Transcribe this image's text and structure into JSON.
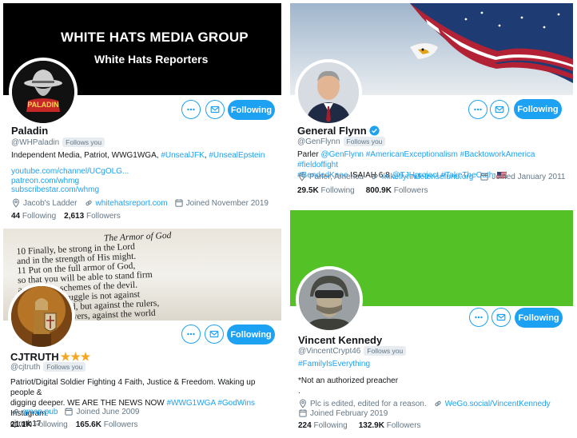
{
  "cards": {
    "paladin": {
      "banner_title": "WHITE HATS MEDIA GROUP",
      "banner_subtitle": "White Hats Reporters",
      "avatar_text": "PALADIN",
      "name": "Paladin",
      "handle": "@WHPaladin",
      "follows_you": "Follows you",
      "bio_plain": "Independent Media, Patriot, WWG1WGA, ",
      "bio_tag1": "#UnsealJFK",
      "bio_sep": ", ",
      "bio_tag2": "#UnsealEpstein",
      "link1": "youtube.com/channel/UCgOLG...",
      "link2": "patreon.com/whmg",
      "link3": "subscribestar.com/whmg",
      "location": "Jacob's Ladder",
      "website": "whitehatsreport.com",
      "joined": "Joined November 2019",
      "following_count": "44",
      "following_label": "Following",
      "followers_count": "2,613",
      "followers_label": "Followers",
      "follow_button": "Following"
    },
    "flynn": {
      "name": "General Flynn",
      "handle": "@GenFlynn",
      "follows_you": "Follows you",
      "bio_line1_plain": "Parler ",
      "bio_line1_links": "@GenFlynn #AmericanExceptionalism #BacktoworkAmerica #fieldoffight",
      "bio_line2_tag": "#BendedKnee",
      "bio_line2_plain": " ISAIAH 6:8 ",
      "bio_line2_links": "@TJHproject #TakeTheOath",
      "location": "Parler, America",
      "website": "mikeflynndefensefund.org",
      "joined": "Joined January 2011",
      "following_count": "29.5K",
      "following_label": "Following",
      "followers_count": "800.9K",
      "followers_label": "Followers",
      "follow_button": "Following"
    },
    "cjtruth": {
      "banner_line1": "The Armor of God",
      "banner_line2": "10 Finally, be strong in the Lord",
      "banner_line3": "and in the strength of His might.",
      "banner_line4": "11 Put on the full armor of God,",
      "banner_line5": "so that you will be able to stand firm",
      "banner_line6": "against the schemes of the devil.",
      "banner_line7": "12 For our struggle is not against",
      "banner_line8": "flesh and blood, but against the rulers,",
      "banner_line9": "against the powers, against the world",
      "name": "CJTRUTH",
      "name_emoji": "★★★",
      "handle": "@cjtruth",
      "follows_you": "Follows you",
      "bio_line1": "Patriot/Digital Soldier Fighting 4 Faith, Justice & Freedom. Waking up people &",
      "bio_line2_plain": "digging deeper. WE ARE THE NEWS NOW ",
      "bio_line2_tags": "#WWG1WGA #GodWins",
      "bio_line2_tail": " Instagram:",
      "bio_line3": "cjtruth17",
      "website": "qmap.pub",
      "joined": "Joined June 2009",
      "following_count": "21.1K",
      "following_label": "Following",
      "followers_count": "165.6K",
      "followers_label": "Followers",
      "follow_button": "Following"
    },
    "kennedy": {
      "name": "Vincent Kennedy",
      "handle": "@VincentCrypt46",
      "follows_you": "Follows you",
      "hashtag": "#FamilyIsEverything",
      "bio": "*Not an authorized preacher",
      "bio_dot": ".",
      "location": "Plc is edited, edited for a reason.",
      "website": "WeGo.social/VincentKennedy",
      "joined": "Joined February 2019",
      "following_count": "224",
      "following_label": "Following",
      "followers_count": "132.9K",
      "followers_label": "Followers",
      "follow_button": "Following"
    }
  },
  "icons": {
    "more": "more-icon",
    "message": "envelope-icon",
    "location": "location-pin-icon",
    "link": "link-icon",
    "calendar": "calendar-icon",
    "verified": "verified-badge-icon"
  },
  "colors": {
    "accent": "#1da1f2",
    "muted": "#657786",
    "kennedy_banner": "#54c127",
    "paladin_banner": "#000000"
  }
}
